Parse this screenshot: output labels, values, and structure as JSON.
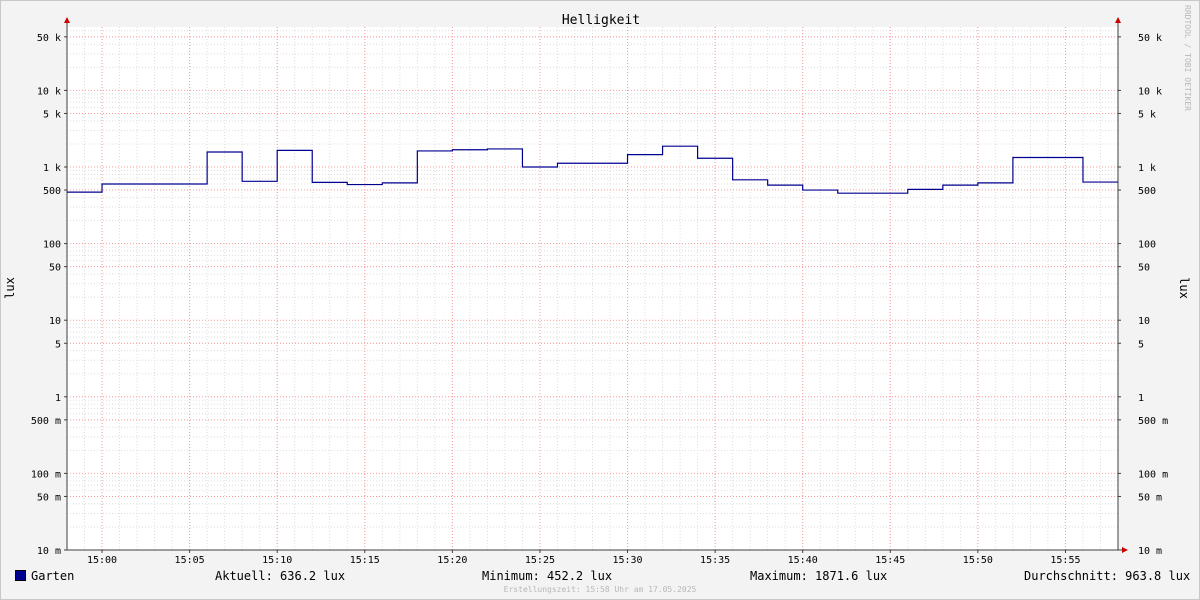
{
  "chart_data": {
    "type": "line",
    "title": "Helligkeit",
    "ylabel": "lux",
    "ylabel_right": "lux",
    "y_scale": "log",
    "ylim": [
      10,
      80000
    ],
    "y_ticks": [
      {
        "v": 50000,
        "label": "50 k"
      },
      {
        "v": 10000,
        "label": "10 k"
      },
      {
        "v": 5000,
        "label": "5 k"
      },
      {
        "v": 1000,
        "label": "1 k"
      },
      {
        "v": 500,
        "label": "500"
      },
      {
        "v": 100,
        "label": "100"
      },
      {
        "v": 50,
        "label": "50"
      },
      {
        "v": 10,
        "label": "10"
      },
      {
        "v": 5,
        "label": "5"
      },
      {
        "v": 1,
        "label": "1"
      },
      {
        "v": 0.5,
        "label": "500 m"
      },
      {
        "v": 0.1,
        "label": "100 m"
      },
      {
        "v": 0.05,
        "label": "50 m"
      },
      {
        "v": 0.01,
        "label": "10 m"
      }
    ],
    "xlim": [
      "14:58",
      "15:58"
    ],
    "x_ticks": [
      "15:00",
      "15:05",
      "15:10",
      "15:15",
      "15:20",
      "15:25",
      "15:30",
      "15:35",
      "15:40",
      "15:45",
      "15:50",
      "15:55"
    ],
    "grid": true,
    "series": [
      {
        "name": "Garten",
        "color": "#000090",
        "step": "post",
        "x": [
          "14:58",
          "15:00",
          "15:06",
          "15:08",
          "15:10",
          "15:12",
          "15:14",
          "15:16",
          "15:18",
          "15:20",
          "15:22",
          "15:24",
          "15:26",
          "15:30",
          "15:32",
          "15:34",
          "15:36",
          "15:38",
          "15:40",
          "15:42",
          "15:44",
          "15:46",
          "15:48",
          "15:50",
          "15:52",
          "15:56",
          "15:58"
        ],
        "values": [
          470,
          600,
          1570,
          650,
          1650,
          630,
          590,
          620,
          1620,
          1680,
          1720,
          1000,
          1120,
          1450,
          1870,
          1300,
          680,
          580,
          500,
          455,
          455,
          510,
          580,
          620,
          1330,
          636,
          636
        ]
      }
    ],
    "legend": "bottom-left",
    "colors": {
      "background": "#f3f3f3",
      "canvas": "#ffffff",
      "major_grid": "#ff9999",
      "minor_grid": "#dddddd",
      "axis": "#404040",
      "arrow": "#cc0000"
    }
  },
  "legend": {
    "series_name": "Garten",
    "swatch_color": "#000090",
    "current": "Aktuell: 636.2 lux",
    "minimum": "Minimum: 452.2 lux",
    "maximum": "Maximum: 1871.6 lux",
    "average": "Durchschnitt: 963.8 lux"
  },
  "footer": "Erstellungszeit: 15:58 Uhr am 17.05.2025",
  "watermark": "RRDTOOL / TOBI OETIKER"
}
